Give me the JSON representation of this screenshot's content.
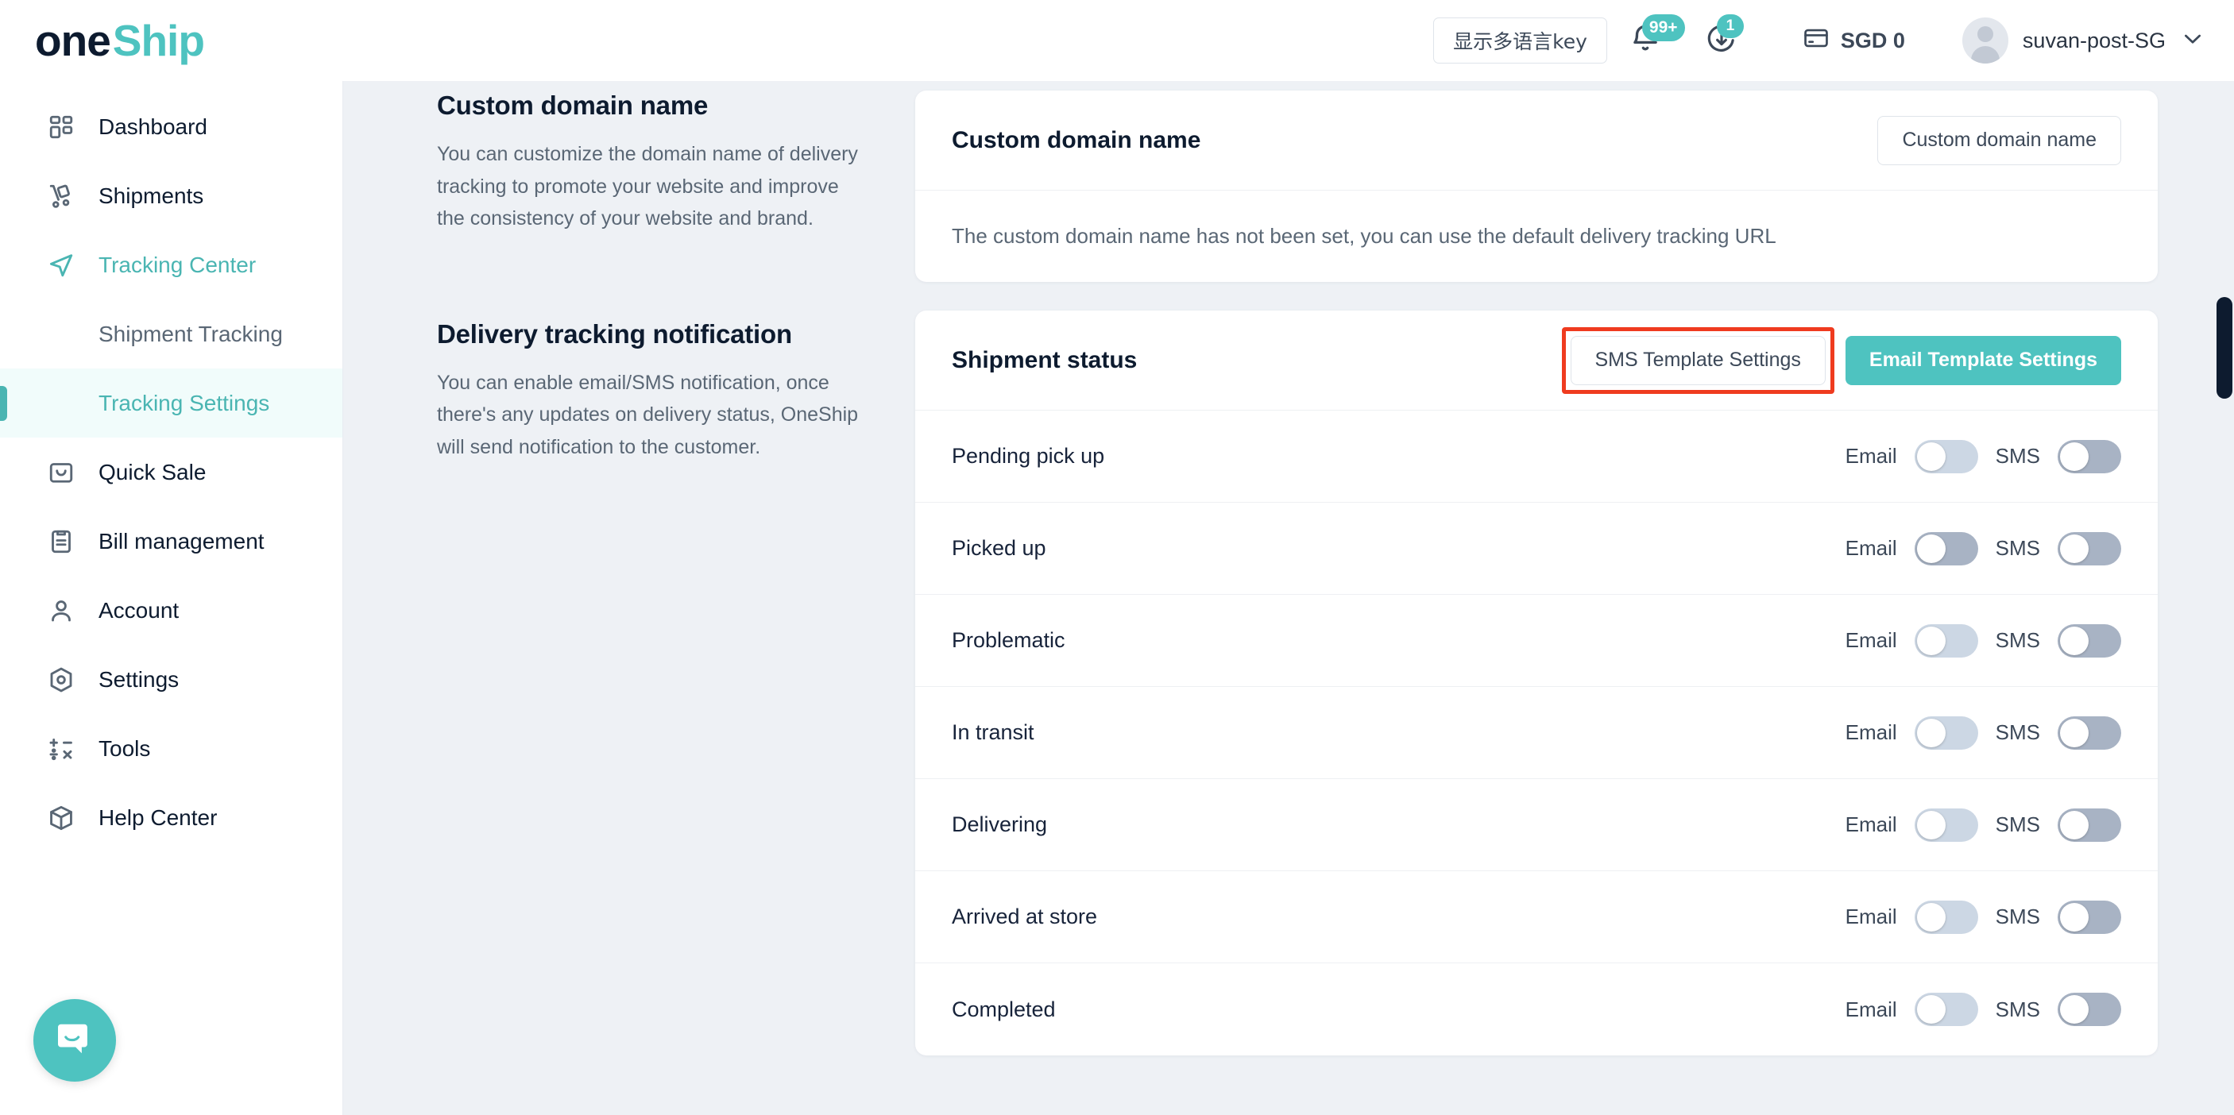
{
  "header": {
    "logo_one": "one",
    "logo_ship": "Ship",
    "lang_button": "显示多语言key",
    "bell_icon": "bell-icon",
    "bell_badge": "99+",
    "sync_icon": "sync-download-icon",
    "sync_badge": "1",
    "wallet_icon": "credit-card-icon",
    "currency": "SGD  0",
    "user_name": "suvan-post-SG",
    "chevron": "chevron-down-icon"
  },
  "sidebar": {
    "items": [
      {
        "label": "Dashboard",
        "icon": "grid-icon",
        "type": "item",
        "state": "default"
      },
      {
        "label": "Shipments",
        "icon": "handtruck-icon",
        "type": "item",
        "state": "default"
      },
      {
        "label": "Tracking Center",
        "icon": "paper-plane-icon",
        "type": "item",
        "state": "teal"
      },
      {
        "label": "Shipment Tracking",
        "icon": "",
        "type": "sub",
        "state": "default"
      },
      {
        "label": "Tracking Settings",
        "icon": "",
        "type": "sub",
        "state": "active"
      },
      {
        "label": "Quick Sale",
        "icon": "bag-icon",
        "type": "item",
        "state": "default"
      },
      {
        "label": "Bill management",
        "icon": "clipboard-icon",
        "type": "item",
        "state": "default"
      },
      {
        "label": "Account",
        "icon": "person-icon",
        "type": "item",
        "state": "default"
      },
      {
        "label": "Settings",
        "icon": "hex-gear-icon",
        "type": "item",
        "state": "default"
      },
      {
        "label": "Tools",
        "icon": "math-ops-icon",
        "type": "item",
        "state": "default"
      },
      {
        "label": "Help Center",
        "icon": "box-icon",
        "type": "item",
        "state": "default"
      }
    ]
  },
  "left_column": {
    "domain_title": "Custom domain name",
    "domain_desc": "You can customize the domain name of delivery tracking to promote your website and improve the consistency of your website and brand.",
    "notif_title": "Delivery tracking notification",
    "notif_desc": "You can enable email/SMS notification, once there's any updates on delivery status, OneShip will send notification to the customer."
  },
  "domain_card": {
    "title": "Custom domain name",
    "button": "Custom domain name",
    "body_text": "The custom domain name has not been set, you can use the default delivery tracking URL"
  },
  "status_card": {
    "title": "Shipment status",
    "sms_button": "SMS Template Settings",
    "email_button": "Email Template Settings",
    "sms_button_highlighted": true,
    "highlight_color": "#ef3b1f",
    "email_label": "Email",
    "sms_label": "SMS",
    "rows": [
      {
        "name": "Pending pick up",
        "email_on": false,
        "sms_on": false,
        "email_muted": true
      },
      {
        "name": "Picked up",
        "email_on": false,
        "sms_on": false,
        "email_muted": false
      },
      {
        "name": "Problematic",
        "email_on": false,
        "sms_on": false,
        "email_muted": true
      },
      {
        "name": "In transit",
        "email_on": false,
        "sms_on": false,
        "email_muted": true
      },
      {
        "name": "Delivering",
        "email_on": false,
        "sms_on": false,
        "email_muted": true
      },
      {
        "name": "Arrived at store",
        "email_on": false,
        "sms_on": false,
        "email_muted": true
      },
      {
        "name": "Completed",
        "email_on": false,
        "sms_on": false,
        "email_muted": true
      }
    ]
  },
  "chat": {
    "icon": "chat-bubble-icon"
  },
  "colors": {
    "accent_teal": "#4ec3c0",
    "sidebar_active_bg": "#f1fcfb",
    "page_bg": "#eef1f5",
    "text_dark": "#0d1b2f",
    "highlight_red": "#ef3b1f",
    "scrollbar": "#0d1b2f"
  }
}
